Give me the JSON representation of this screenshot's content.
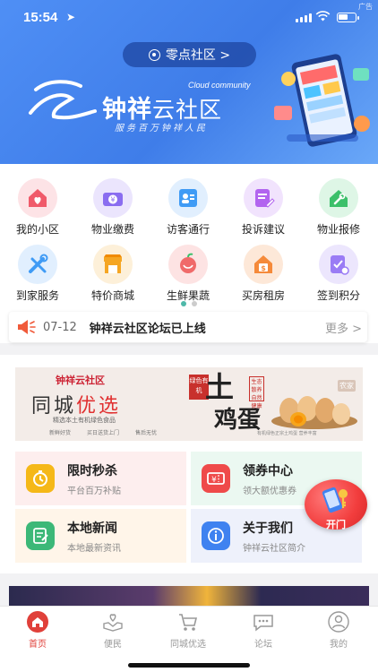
{
  "status": {
    "time": "15:54",
    "ad_tag": "广告"
  },
  "header": {
    "community_button": "零点社区 >",
    "brand_english": "Cloud community",
    "brand_name_part1": "钟祥",
    "brand_name_part2": "云社区",
    "brand_slogan": "服务百万钟祥人民"
  },
  "menu": {
    "items": [
      {
        "label": "我的小区",
        "icon": "house-heart-icon",
        "color": "#f05a6a"
      },
      {
        "label": "物业缴费",
        "icon": "yen-coin-icon",
        "color": "#8a6df0"
      },
      {
        "label": "访客通行",
        "icon": "visitor-card-icon",
        "color": "#3f9bf5"
      },
      {
        "label": "投诉建议",
        "icon": "complaint-edit-icon",
        "color": "#b264ef"
      },
      {
        "label": "物业报修",
        "icon": "repair-tools-icon",
        "color": "#3cc06a"
      },
      {
        "label": "到家服务",
        "icon": "wrench-screwdriver-icon",
        "color": "#3f9bf5"
      },
      {
        "label": "特价商城",
        "icon": "shop-icon",
        "color": "#f5a623"
      },
      {
        "label": "生鲜果蔬",
        "icon": "fruit-bowl-icon",
        "color": "#f06a6a"
      },
      {
        "label": "买房租房",
        "icon": "house-dollar-icon",
        "color": "#f58a3a"
      },
      {
        "label": "签到积分",
        "icon": "checkin-icon",
        "color": "#9a7cf5"
      }
    ],
    "page_count": 2,
    "active_page": 1
  },
  "notice": {
    "date": "07-12",
    "text": "钟祥云社区论坛已上线",
    "more": "更多 >"
  },
  "promo": {
    "logo": "钟祥云社区",
    "title_part1": "同城",
    "title_part2": "优选",
    "subtitle": "精选本土有机绿色食品",
    "tags": [
      "新鲜好货",
      "买日送货上门",
      "售后无忧"
    ],
    "stamp_text": "绿色有机",
    "egg_title1": "土",
    "egg_title2": "鸡蛋",
    "seal_text": "生态散养自然健康",
    "chick_tag": "农家",
    "footer": "有机绿色正宗土鸡蛋 营养丰富"
  },
  "cards": [
    {
      "title": "限时秒杀",
      "subtitle": "平台百万补贴",
      "icon": "stopwatch-icon",
      "color": "#f5b818",
      "bg": "#fdeeee"
    },
    {
      "title": "领券中心",
      "subtitle": "领大额优惠券",
      "icon": "coupon-icon",
      "color": "#ef4a4a",
      "bg": "#ebf8f1"
    },
    {
      "title": "本地新闻",
      "subtitle": "本地最新资讯",
      "icon": "news-icon",
      "color": "#3cb878",
      "bg": "#fff5e9"
    },
    {
      "title": "关于我们",
      "subtitle": "钟祥云社区简介",
      "icon": "info-icon",
      "color": "#3f82f0",
      "bg": "#eef1fb"
    }
  ],
  "float_button": {
    "label": "开门",
    "icon": "phone-key-icon"
  },
  "tabs": [
    {
      "label": "首页",
      "icon": "home-icon",
      "active": true
    },
    {
      "label": "便民",
      "icon": "hands-heart-icon",
      "active": false
    },
    {
      "label": "同城优选",
      "icon": "cart-icon",
      "active": false
    },
    {
      "label": "论坛",
      "icon": "chat-bubble-icon",
      "active": false
    },
    {
      "label": "我的",
      "icon": "user-icon",
      "active": false
    }
  ]
}
